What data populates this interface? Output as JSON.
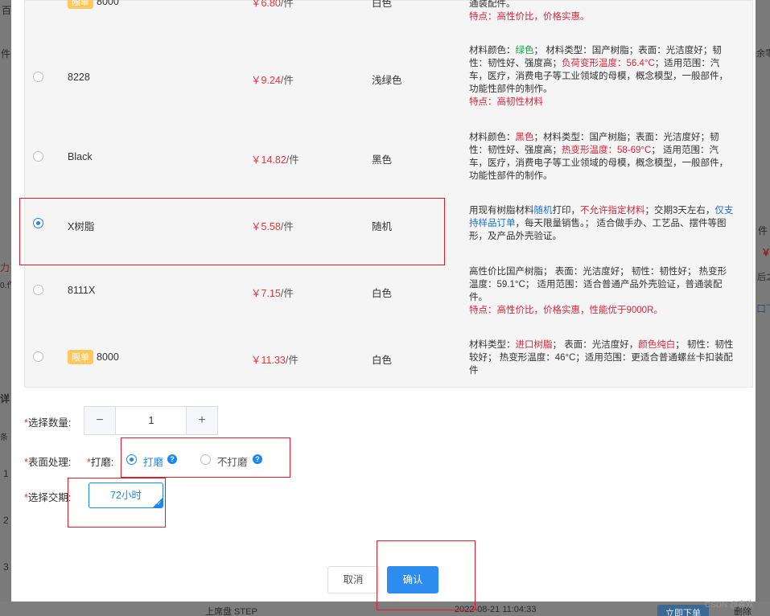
{
  "background": {
    "left_texts": [
      "百",
      "件",
      "力了",
      "0.作",
      "详",
      "条",
      "1",
      "2",
      "3"
    ],
    "right_texts": [
      "余零",
      "件",
      "￥",
      "后之",
      "口下"
    ],
    "bottom": {
      "file_type": "上席盘 STEP",
      "datetime": "2022-08-21 11:04:33",
      "order_now": "立即下单",
      "delete": "删除"
    }
  },
  "materials": [
    {
      "name": "8000",
      "tag": "限单",
      "price": "￥6.80",
      "unit": "/件",
      "color": "白色",
      "desc": [
        {
          "t": "通装配件。",
          "c": ""
        },
        {
          "t": "\n特点：高性价比，价格实惠。",
          "c": "r"
        }
      ]
    },
    {
      "name": "8228",
      "tag": "",
      "price": "￥9.24",
      "unit": "/件",
      "color": "浅绿色",
      "desc": [
        {
          "t": "材料颜色：",
          "c": ""
        },
        {
          "t": "绿色",
          "c": "g"
        },
        {
          "t": "； 材料类型：国产树脂；表面：光洁度好；韧性：韧性好、强度高；",
          "c": ""
        },
        {
          "t": "负荷变形温度：56.4°C",
          "c": "r"
        },
        {
          "t": "；适用范围：汽车，医疗，消费电子等工业领域的母模，概念模型，一般部件，功能性部件的制作。",
          "c": ""
        },
        {
          "t": "\n特点：高韧性材料",
          "c": "r"
        }
      ]
    },
    {
      "name": "Black",
      "tag": "",
      "price": "￥14.82",
      "unit": "/件",
      "color": "黑色",
      "desc": [
        {
          "t": "材料颜色：",
          "c": ""
        },
        {
          "t": "黑色",
          "c": "r"
        },
        {
          "t": "；材料类型：国产树脂；表面：光洁度好；韧性：韧性好、强度高；",
          "c": ""
        },
        {
          "t": "热变形温度：58-69°C",
          "c": "r"
        },
        {
          "t": "； 适用范围：汽车，医疗，消费电子等工业领域的母模，概念模型，一般部件，功能性部件的制作。",
          "c": ""
        }
      ]
    },
    {
      "name": "X树脂",
      "tag": "",
      "price": "￥5.58",
      "unit": "/件",
      "color": "随机",
      "desc": [
        {
          "t": "用现有树脂材料",
          "c": ""
        },
        {
          "t": "随机",
          "c": "b"
        },
        {
          "t": "打印，",
          "c": ""
        },
        {
          "t": "不允许指定材料",
          "c": "r"
        },
        {
          "t": "；交期3天左右，",
          "c": ""
        },
        {
          "t": "仅支持样品订单",
          "c": "b"
        },
        {
          "t": "，每天限量销售。； 适合做手办、工艺品、摆件等图形，及产品外壳验证。",
          "c": ""
        }
      ]
    },
    {
      "name": "8111X",
      "tag": "",
      "price": "￥7.15",
      "unit": "/件",
      "color": "白色",
      "desc": [
        {
          "t": "高性价比国产树脂； 表面：光洁度好； 韧性：韧性好； 热变形温度：59.1°C； 适用范围：适合普通产品外壳验证，普通装配件。",
          "c": ""
        },
        {
          "t": "\n特点：高性价比，价格实惠，性能优于9000R。",
          "c": "r"
        }
      ]
    },
    {
      "name": "8000",
      "tag": "限单",
      "price": "￥11.33",
      "unit": "/件",
      "color": "白色",
      "desc": [
        {
          "t": "材料类型：",
          "c": ""
        },
        {
          "t": "进口树脂",
          "c": "r"
        },
        {
          "t": "； 表面：光洁度好，",
          "c": ""
        },
        {
          "t": "颜色纯白",
          "c": "r"
        },
        {
          "t": "； 韧性：韧性较好； 热变形温度：46°C；适用范围：更适合普通螺丝卡扣装配件",
          "c": ""
        }
      ]
    }
  ],
  "selected_index": 3,
  "form": {
    "quantity_label": "选择数量:",
    "quantity_value": "1",
    "minus": "−",
    "plus": "+",
    "surface_label": "表面处理:",
    "polish_label": "打磨:",
    "polish_option": "打磨",
    "no_polish_option": "不打磨",
    "help": "?",
    "delivery_label": "选择交期:",
    "delivery_option": "72小时",
    "required_star": "*"
  },
  "buttons": {
    "cancel": "取消",
    "confirm": "确认"
  },
  "watermark": "CSDN @喜欢",
  "colors": {
    "primary": "#1b86f5",
    "price": "#e0363c",
    "highlight_box": "#e21c2c"
  }
}
